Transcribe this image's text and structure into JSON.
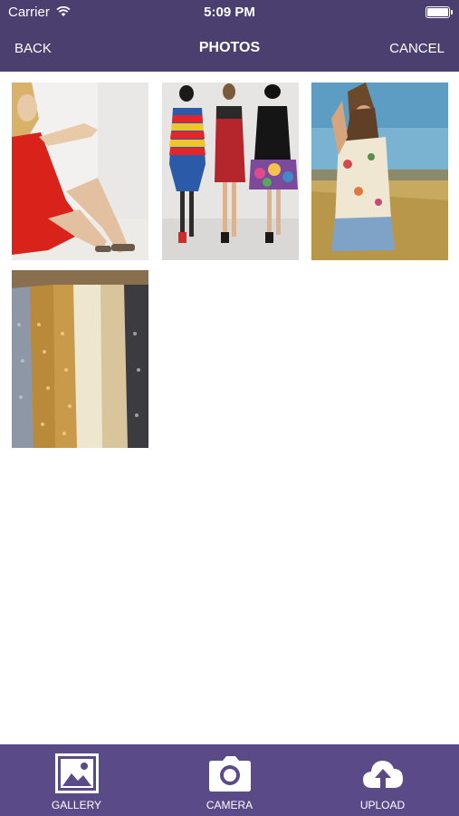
{
  "status_bar": {
    "carrier": "Carrier",
    "time": "5:09 PM"
  },
  "nav": {
    "back": "BACK",
    "title": "PHOTOS",
    "cancel": "CANCEL"
  },
  "photos": [
    {
      "alt": "Model in red dress seated"
    },
    {
      "alt": "Three runway models"
    },
    {
      "alt": "Woman in field wearing floral top"
    },
    {
      "alt": "Sequined dresses on hangers"
    }
  ],
  "tabs": [
    {
      "label": "GALLERY",
      "icon": "gallery-icon"
    },
    {
      "label": "CAMERA",
      "icon": "camera-icon"
    },
    {
      "label": "UPLOAD",
      "icon": "upload-cloud-icon"
    }
  ],
  "colors": {
    "header": "#4b3f6f",
    "tabbar": "#5a4b88",
    "background": "#ffffff"
  }
}
